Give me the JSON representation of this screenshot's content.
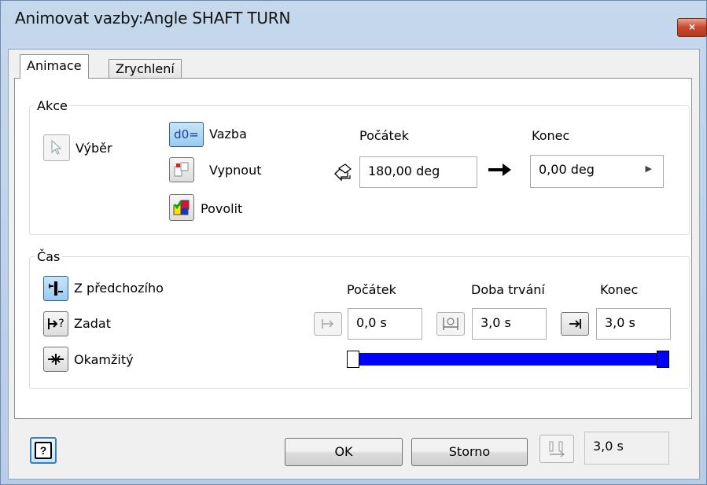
{
  "window": {
    "title": "Animovat vazby:Angle SHAFT TURN",
    "close_glyph": "×"
  },
  "tabs": [
    {
      "label": "Animace"
    },
    {
      "label": "Zrychlení"
    }
  ],
  "akce": {
    "legend": "Akce",
    "select_label": "Výběr",
    "vazba_label": "Vazba",
    "vazba_icon_text": "d0=",
    "vypnout_label": "Vypnout",
    "povolit_label": "Povolit",
    "start_label": "Počátek",
    "start_value": "180,00 deg",
    "end_label": "Konec",
    "end_value": "0,00 deg"
  },
  "cas": {
    "legend": "Čas",
    "z_predchoziho_label": "Z předchozího",
    "zadat_label": "Zadat",
    "zadat_icon_text": "?",
    "okamzity_label": "Okamžitý",
    "start_label": "Počátek",
    "duration_label": "Doba trvání",
    "end_label": "Konec",
    "start_value": "0,0 s",
    "duration_value": "3,0 s",
    "end_value": "3,0 s",
    "slider_start_fraction": 0.0,
    "slider_end_fraction": 1.0
  },
  "footer": {
    "help_glyph": "?",
    "ok_label": "OK",
    "cancel_label": "Storno",
    "total_time_value": "3,0 s"
  },
  "colors": {
    "slider": "#0000ff",
    "pressed_button": "#98cbef",
    "title_bar": "#c5d8ec"
  },
  "icons": [
    "cursor-arrow-icon",
    "constraint-d0-icon",
    "suppress-icon",
    "enable-icon",
    "flip-direction-icon",
    "arrow-right-icon",
    "chevron-right-icon",
    "from-previous-icon",
    "specify-icon",
    "instantaneous-icon",
    "start-time-icon",
    "duration-icon",
    "end-time-icon",
    "help-icon",
    "total-time-icon"
  ]
}
